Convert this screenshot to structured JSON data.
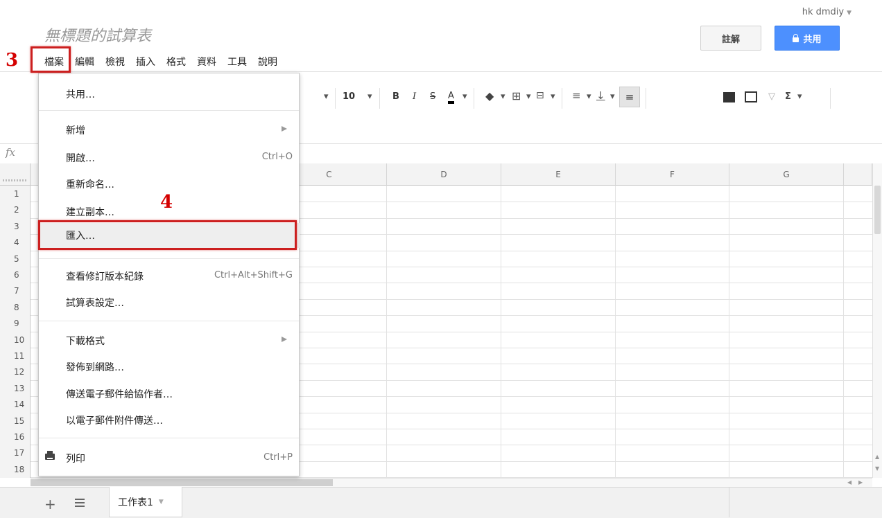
{
  "header": {
    "user": "hk dmdiy",
    "doc_title": "無標題的試算表",
    "comments_label": "註解",
    "share_label": "共用"
  },
  "menubar": [
    "檔案",
    "編輯",
    "檢視",
    "插入",
    "格式",
    "資料",
    "工具",
    "說明"
  ],
  "annotations": {
    "step3": "3",
    "step4": "4"
  },
  "toolbar": {
    "font_size": "10",
    "bold": "B",
    "italic": "I",
    "strike": "S",
    "text_color": "A",
    "sum": "Σ"
  },
  "formula_bar": {
    "fx": "fx"
  },
  "columns": [
    "C",
    "D",
    "E",
    "F",
    "G"
  ],
  "rows": [
    "1",
    "2",
    "3",
    "4",
    "5",
    "6",
    "7",
    "8",
    "9",
    "10",
    "11",
    "12",
    "13",
    "14",
    "15",
    "16",
    "17",
    "18"
  ],
  "file_menu": {
    "share": "共用…",
    "new": "新增",
    "open": "開啟…",
    "open_shortcut": "Ctrl+O",
    "rename": "重新命名…",
    "copy": "建立副本…",
    "import": "匯入…",
    "revisions": "查看修訂版本紀錄",
    "revisions_shortcut": "Ctrl+Alt+Shift+G",
    "settings": "試算表設定…",
    "download": "下載格式",
    "publish": "發佈到網路…",
    "email_collab": "傳送電子郵件給協作者…",
    "email_attach": "以電子郵件附件傳送…",
    "print": "列印",
    "print_shortcut": "Ctrl+P"
  },
  "sheets": {
    "add": "+",
    "tab1": "工作表1"
  },
  "colors": {
    "accent": "#4d90fe",
    "highlight": "#cc1f1f",
    "annotation": "#d40000"
  }
}
